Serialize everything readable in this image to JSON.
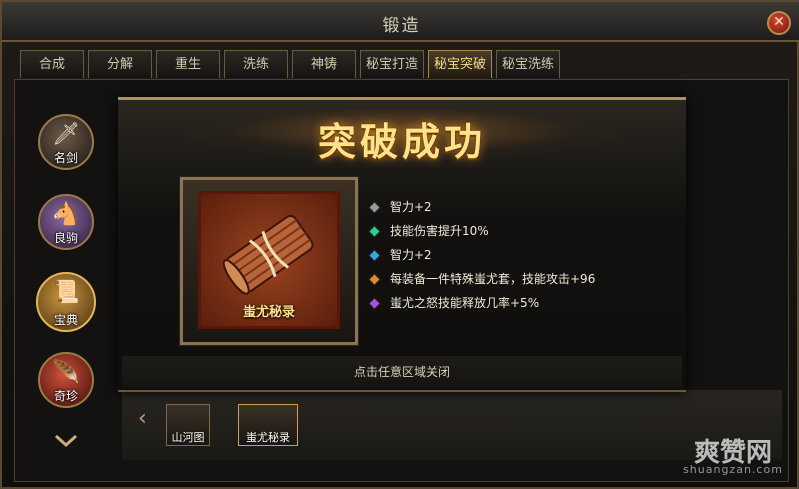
{
  "window": {
    "title": "锻造",
    "close_label": "✕"
  },
  "tabs": [
    {
      "label": "合成",
      "active": false
    },
    {
      "label": "分解",
      "active": false
    },
    {
      "label": "重生",
      "active": false
    },
    {
      "label": "洗练",
      "active": false
    },
    {
      "label": "神铸",
      "active": false
    },
    {
      "label": "秘宝打造",
      "active": false
    },
    {
      "label": "秘宝突破",
      "active": true
    },
    {
      "label": "秘宝洗练",
      "active": false
    }
  ],
  "sidebar": {
    "items": [
      {
        "label": "名剑",
        "icon": "sword-icon"
      },
      {
        "label": "良驹",
        "icon": "horse-icon"
      },
      {
        "label": "宝典",
        "icon": "book-icon",
        "selected": true
      },
      {
        "label": "奇珍",
        "icon": "feather-icon"
      }
    ]
  },
  "bottom_slots": [
    {
      "label": "山河图"
    },
    {
      "label": "蚩尤秘录",
      "selected": true
    }
  ],
  "modal": {
    "banner": "突破成功",
    "item_name": "蚩尤秘录",
    "attributes": [
      {
        "text": "智力+2",
        "color": "#9a9a9a"
      },
      {
        "text": "技能伤害提升10%",
        "color": "#2fd08a"
      },
      {
        "text": "智力+2",
        "color": "#3aa7e0"
      },
      {
        "text": "每装备一件特殊蚩尤套，技能攻击+96",
        "color": "#e08a2a"
      },
      {
        "text": "蚩尤之怒技能释放几率+5%",
        "color": "#b050d8"
      }
    ],
    "hint": "点击任意区域关闭"
  },
  "watermark": {
    "main": "爽赞网",
    "sub": "shuangzan.com"
  }
}
